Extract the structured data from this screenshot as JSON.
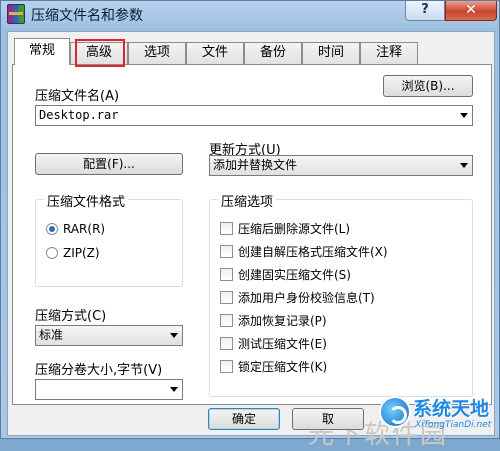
{
  "window": {
    "title": "压缩文件名和参数",
    "help_glyph": "?",
    "close_glyph": "✕"
  },
  "tabs": [
    {
      "label": "常规",
      "active": true
    },
    {
      "label": "高级",
      "active": false,
      "highlighted": true
    },
    {
      "label": "选项",
      "active": false
    },
    {
      "label": "文件",
      "active": false
    },
    {
      "label": "备份",
      "active": false
    },
    {
      "label": "时间",
      "active": false
    },
    {
      "label": "注释",
      "active": false
    }
  ],
  "archive_name": {
    "label": "压缩文件名(A)",
    "value": "Desktop.rar",
    "browse_label": "浏览(B)..."
  },
  "update_mode": {
    "label": "更新方式(U)",
    "value": "添加并替换文件"
  },
  "profile_button": "配置(F)...",
  "format_group": {
    "title": "压缩文件格式",
    "options": [
      {
        "label": "RAR(R)",
        "selected": true
      },
      {
        "label": "ZIP(Z)",
        "selected": false
      }
    ]
  },
  "options_group": {
    "title": "压缩选项",
    "items": [
      {
        "label": "压缩后删除源文件(L)",
        "checked": false
      },
      {
        "label": "创建自解压格式压缩文件(X)",
        "checked": false
      },
      {
        "label": "创建固实压缩文件(S)",
        "checked": false
      },
      {
        "label": "添加用户身份校验信息(T)",
        "checked": false
      },
      {
        "label": "添加恢复记录(P)",
        "checked": false
      },
      {
        "label": "测试压缩文件(E)",
        "checked": false
      },
      {
        "label": "锁定压缩文件(K)",
        "checked": false
      }
    ]
  },
  "method": {
    "label": "压缩方式(C)",
    "value": "标准"
  },
  "split": {
    "label": "压缩分卷大小,字节(V)",
    "value": ""
  },
  "buttons": {
    "ok": "确定",
    "cancel_partial": "取"
  },
  "watermark": {
    "faint_text": "光下软件园",
    "brand": "系统天地",
    "url": "XiTongTianDi.net"
  },
  "colors": {
    "highlight_box": "#e0252a",
    "close_button": "#c8452f",
    "brand": "#1e88e5"
  }
}
